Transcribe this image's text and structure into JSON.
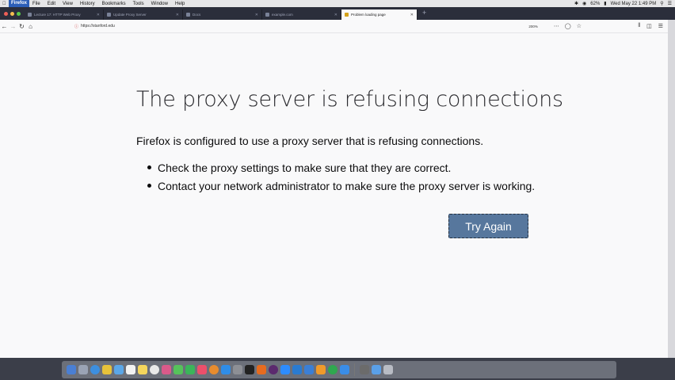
{
  "menubar": {
    "app_name": "Firefox",
    "items": [
      "File",
      "Edit",
      "View",
      "History",
      "Bookmarks",
      "Tools",
      "Window",
      "Help"
    ],
    "battery": "62%",
    "clock": "Wed May 22  1:49 PM"
  },
  "tabs": [
    {
      "title": "Lecture 17: HTTP Web Proxy",
      "active": false
    },
    {
      "title": "Update Proxy Server",
      "active": false
    },
    {
      "title": "Docs",
      "active": false
    },
    {
      "title": "example.com",
      "active": false
    },
    {
      "title": "Problem loading page",
      "active": true
    }
  ],
  "navbar": {
    "url": "https://stanford.edu",
    "zoom": "200%"
  },
  "error": {
    "title": "The proxy server is refusing connections",
    "description": "Firefox is configured to use a proxy server that is refusing connections.",
    "items": [
      "Check the proxy settings to make sure that they are correct.",
      "Contact your network administrator to make sure the proxy server is working."
    ],
    "button_label": "Try Again"
  },
  "colors": {
    "button_bg": "#57779d",
    "page_bg": "#f9f9fa",
    "tabstrip_bg": "#2b2e3b"
  },
  "dock": {
    "icons": [
      "finder",
      "launchpad",
      "safari",
      "chrome",
      "mail",
      "calendar",
      "notes",
      "reminders",
      "photos",
      "messages",
      "facetime",
      "music",
      "books",
      "app-store",
      "preferences",
      "terminal",
      "firefox",
      "slack",
      "zoom",
      "vscode",
      "keynote",
      "pages",
      "numbers",
      "xcode",
      "activity-monitor",
      "downloads",
      "trash"
    ]
  }
}
